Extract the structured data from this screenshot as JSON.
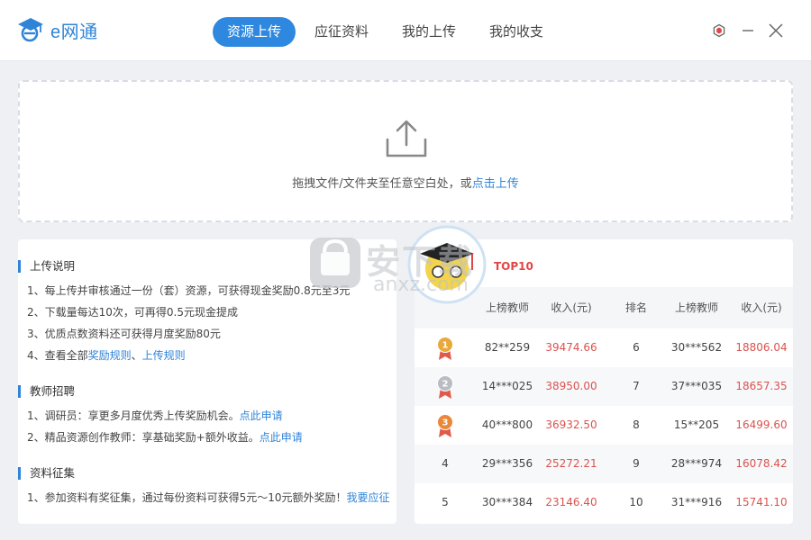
{
  "app": {
    "name": "e网通"
  },
  "nav": {
    "tabs": [
      {
        "label": "资源上传",
        "active": true
      },
      {
        "label": "应征资料",
        "active": false
      },
      {
        "label": "我的上传",
        "active": false
      },
      {
        "label": "我的收支",
        "active": false
      }
    ]
  },
  "window": {
    "icons": [
      "hexagon-icon",
      "minimize-icon",
      "close-icon"
    ]
  },
  "upload": {
    "hint_prefix": "拖拽文件/文件夹至任意空白处，或",
    "hint_link": "点击上传"
  },
  "info": {
    "sections": [
      {
        "title": "上传说明",
        "lines": [
          {
            "text": "1、每上传并审核通过一份（套）资源，可获得现金奖励0.8元至3元"
          },
          {
            "text": "2、下载量每达10次，可再得0.5元现金提成"
          },
          {
            "text": "3、优质点数资料还可获得月度奖励80元"
          },
          {
            "text": "4、查看全部",
            "links": [
              "奖励规则",
              "上传规则"
            ],
            "sep": "、"
          }
        ]
      },
      {
        "title": "教师招聘",
        "lines": [
          {
            "text": "1、调研员：享更多月度优秀上传奖励机会。",
            "links": [
              "点此申请"
            ]
          },
          {
            "text": "2、精品资源创作教师：享基础奖励+额外收益。",
            "links": [
              "点此申请"
            ]
          }
        ]
      },
      {
        "title": "资料征集",
        "lines": [
          {
            "text": "1、参加资料有奖征集，通过每份资料可获得5元～10元额外奖励！",
            "links": [
              "我要应征"
            ]
          }
        ]
      }
    ]
  },
  "ranking": {
    "badge": "TOP10",
    "headers": {
      "teacher": "上榜教师",
      "income": "收入(元)",
      "rank": "排名"
    },
    "left": [
      {
        "rank": "1",
        "teacher": "82**259",
        "income": "39474.66"
      },
      {
        "rank": "2",
        "teacher": "14***025",
        "income": "38950.00"
      },
      {
        "rank": "3",
        "teacher": "40***800",
        "income": "36932.50"
      },
      {
        "rank": "4",
        "teacher": "29***356",
        "income": "25272.21"
      },
      {
        "rank": "5",
        "teacher": "30***384",
        "income": "23146.40"
      }
    ],
    "right": [
      {
        "rank": "6",
        "teacher": "30***562",
        "income": "18806.04"
      },
      {
        "rank": "7",
        "teacher": "37***035",
        "income": "18657.35"
      },
      {
        "rank": "8",
        "teacher": "15**205",
        "income": "16499.60"
      },
      {
        "rank": "9",
        "teacher": "28***974",
        "income": "16078.42"
      },
      {
        "rank": "10",
        "teacher": "31***916",
        "income": "15741.10"
      }
    ],
    "medal_colors": [
      "#e9a93a",
      "#b9bcc2",
      "#e9883a"
    ]
  },
  "watermark": {
    "text": "安下载",
    "sub": "anxz.com"
  },
  "colors": {
    "accent": "#2f88df",
    "money": "#d9534f"
  }
}
